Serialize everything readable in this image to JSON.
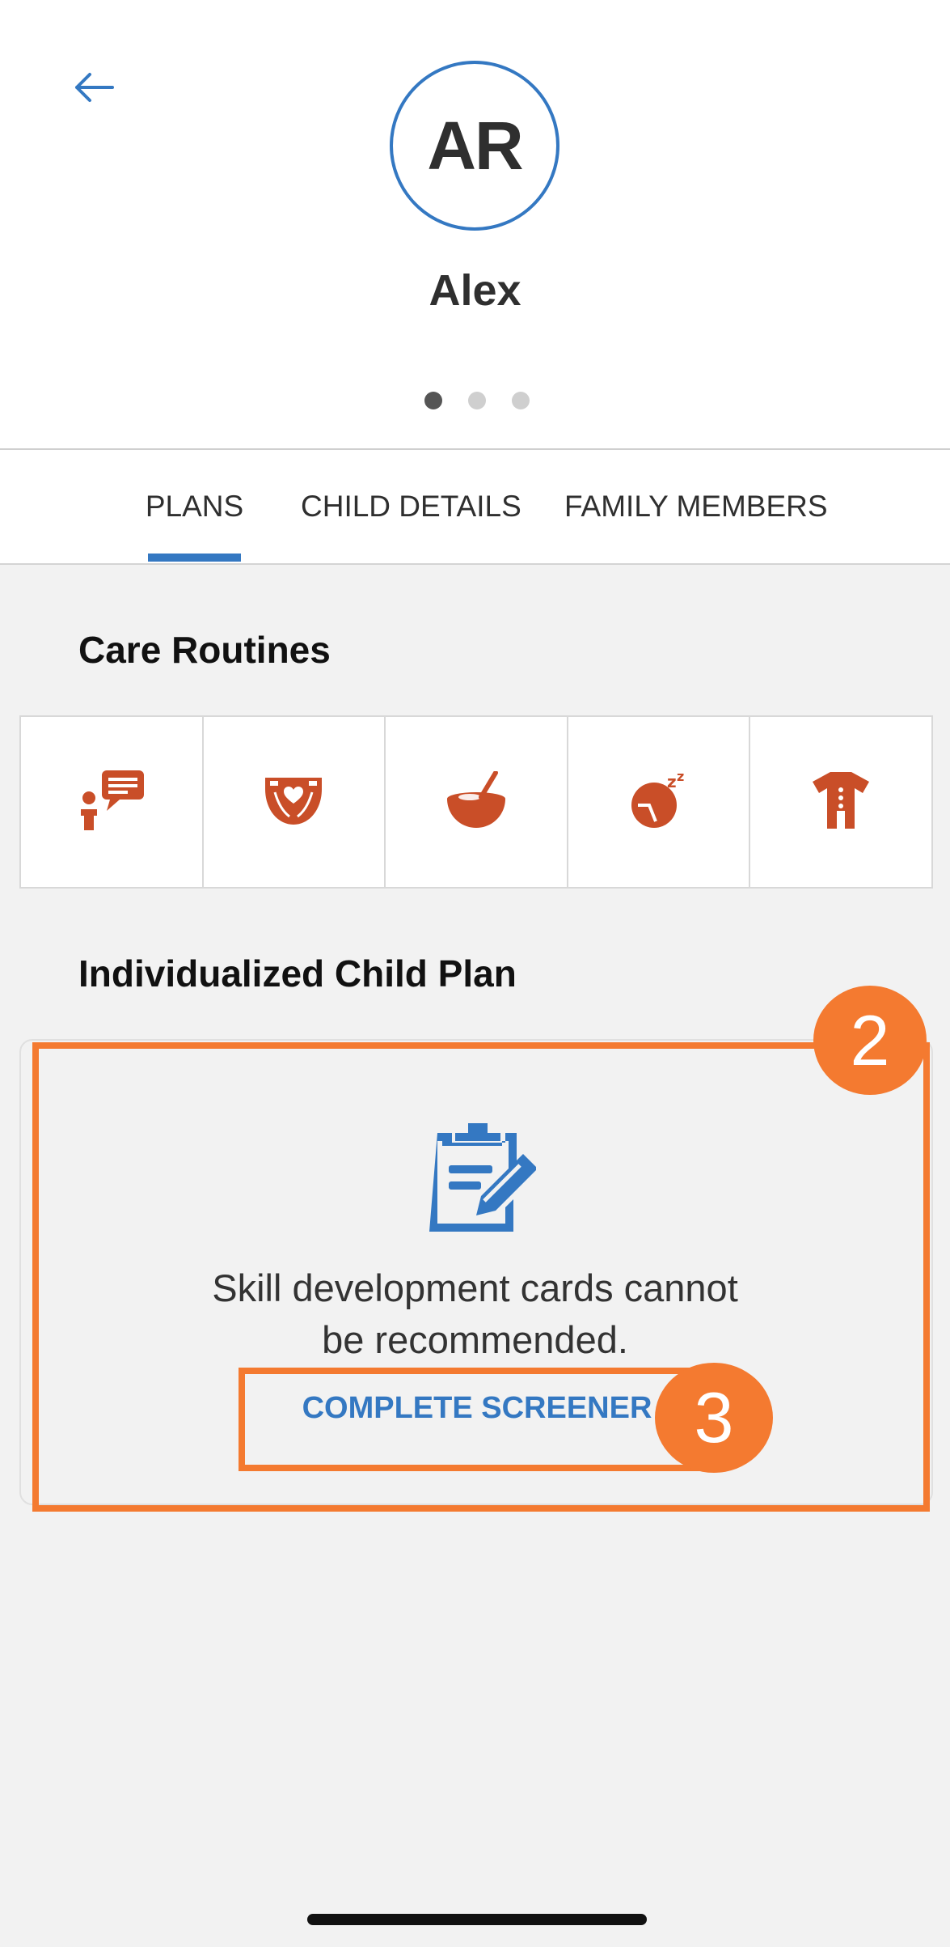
{
  "header": {
    "back_icon": "arrow-left-icon",
    "avatar_initials": "AR",
    "child_name": "Alex",
    "pager": {
      "count": 3,
      "active_index": 0
    }
  },
  "tabs": [
    {
      "label": "PLANS",
      "active": true
    },
    {
      "label": "CHILD DETAILS",
      "active": false
    },
    {
      "label": "FAMILY MEMBERS",
      "active": false
    }
  ],
  "care_routines": {
    "title": "Care Routines",
    "items": [
      {
        "icon": "communication-icon"
      },
      {
        "icon": "diaper-icon"
      },
      {
        "icon": "feeding-bowl-icon"
      },
      {
        "icon": "sleep-icon"
      },
      {
        "icon": "dressing-onesie-icon"
      }
    ]
  },
  "plan": {
    "title": "Individualized Child Plan",
    "icon": "clipboard-edit-icon",
    "message_line1": "Skill development cards cannot",
    "message_line2": "be recommended.",
    "button_label": "COMPLETE SCREENER"
  },
  "annotations": [
    {
      "label": "2"
    },
    {
      "label": "3"
    }
  ],
  "colors": {
    "accent_blue": "#3478c2",
    "routine_orange": "#c94e28",
    "highlight_orange": "#f47a30"
  }
}
